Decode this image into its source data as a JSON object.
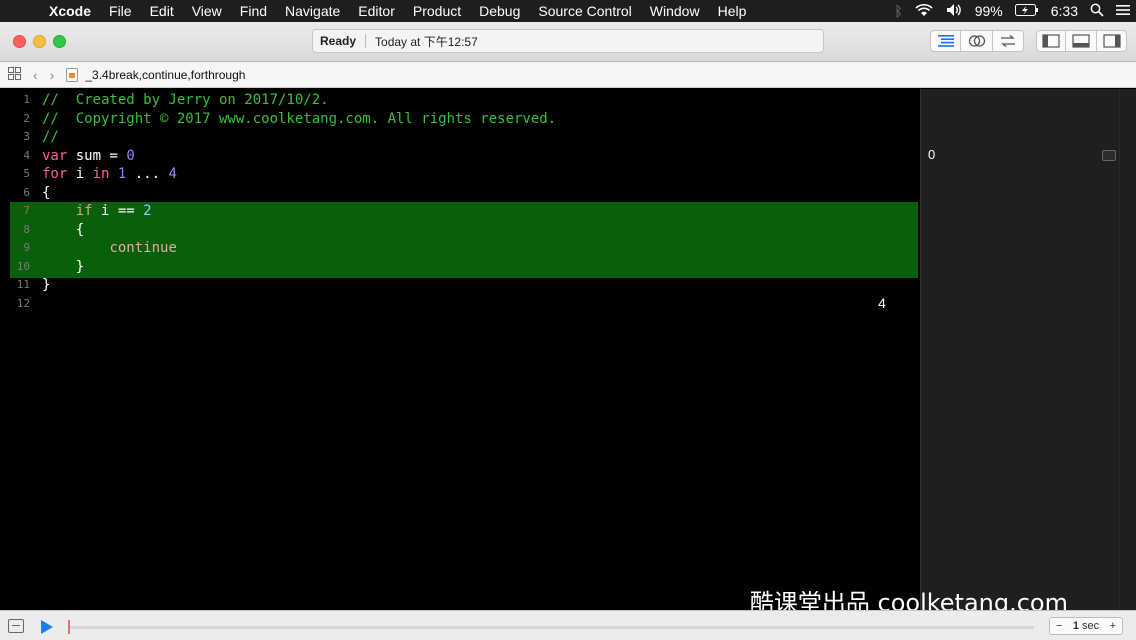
{
  "menubar": {
    "apple": "",
    "items": [
      "Xcode",
      "File",
      "Edit",
      "View",
      "Find",
      "Navigate",
      "Editor",
      "Product",
      "Debug",
      "Source Control",
      "Window",
      "Help"
    ],
    "battery": "99%",
    "time": "6:33"
  },
  "toolbar": {
    "status": "Ready",
    "timestamp": "Today at 下午12:57"
  },
  "jumpbar": {
    "filename": "_3.4break,continue,forthrough"
  },
  "editor": {
    "lines": [
      {
        "n": "1",
        "tokens": [
          {
            "t": "//  Created by Jerry on 2017/10/2.",
            "c": "c-comment"
          }
        ]
      },
      {
        "n": "2",
        "tokens": [
          {
            "t": "//  Copyright © 2017 www.coolketang.com. All rights reserved.",
            "c": "c-comment"
          }
        ]
      },
      {
        "n": "3",
        "tokens": [
          {
            "t": "//",
            "c": "c-comment"
          }
        ]
      },
      {
        "n": "4",
        "tokens": [
          {
            "t": "var",
            "c": "c-kw"
          },
          {
            "t": " sum = ",
            "c": "c-plain"
          },
          {
            "t": "0",
            "c": "c-num"
          }
        ]
      },
      {
        "n": "5",
        "tokens": [
          {
            "t": "for",
            "c": "c-kw"
          },
          {
            "t": " i ",
            "c": "c-plain"
          },
          {
            "t": "in",
            "c": "c-kw"
          },
          {
            "t": " ",
            "c": "c-plain"
          },
          {
            "t": "1",
            "c": "c-num"
          },
          {
            "t": " ... ",
            "c": "c-plain"
          },
          {
            "t": "4",
            "c": "c-num"
          }
        ]
      },
      {
        "n": "6",
        "tokens": [
          {
            "t": "{",
            "c": "c-plain"
          }
        ]
      },
      {
        "n": "7",
        "tokens": [
          {
            "t": "    ",
            "c": "c-plain"
          },
          {
            "t": "if",
            "c": "c-hl-kw"
          },
          {
            "t": " i == ",
            "c": "c-plain"
          },
          {
            "t": "2",
            "c": "c-hl-num"
          }
        ]
      },
      {
        "n": "8",
        "tokens": [
          {
            "t": "    {",
            "c": "c-plain"
          }
        ]
      },
      {
        "n": "9",
        "tokens": [
          {
            "t": "        ",
            "c": "c-plain"
          },
          {
            "t": "continue",
            "c": "c-cont"
          }
        ]
      },
      {
        "n": "10",
        "tokens": [
          {
            "t": "    }",
            "c": "c-plain"
          }
        ]
      },
      {
        "n": "11",
        "tokens": [
          {
            "t": "}",
            "c": "c-plain"
          }
        ]
      },
      {
        "n": "12",
        "tokens": []
      }
    ],
    "highlight_count": "4"
  },
  "results": {
    "sum_value": "0"
  },
  "watermark": "酷课堂出品 coolketang.com",
  "bottombar": {
    "stepper_minus": "−",
    "stepper_value": "1",
    "stepper_unit": "sec",
    "stepper_plus": "+"
  }
}
